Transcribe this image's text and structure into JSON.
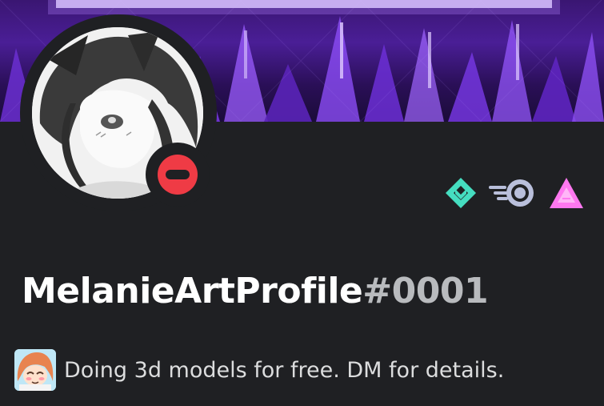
{
  "profile": {
    "username": "MelanieArtProfile",
    "discriminator": "#0001",
    "status": "dnd",
    "custom_status": "Doing 3d models for free. DM for details.",
    "status_emoji": "blushing-girl-emoji"
  },
  "badges": [
    {
      "name": "hypesquad-balance-icon",
      "color": "#45ddc0"
    },
    {
      "name": "nitro-boost-icon",
      "color": "#b9bfdb"
    },
    {
      "name": "early-supporter-icon",
      "color": "#ff78f0"
    }
  ],
  "colors": {
    "background": "#1f2023",
    "banner": "#4a1e96",
    "dnd": "#ef3b45",
    "text": "#ffffff",
    "muted": "#b9bbbe"
  }
}
